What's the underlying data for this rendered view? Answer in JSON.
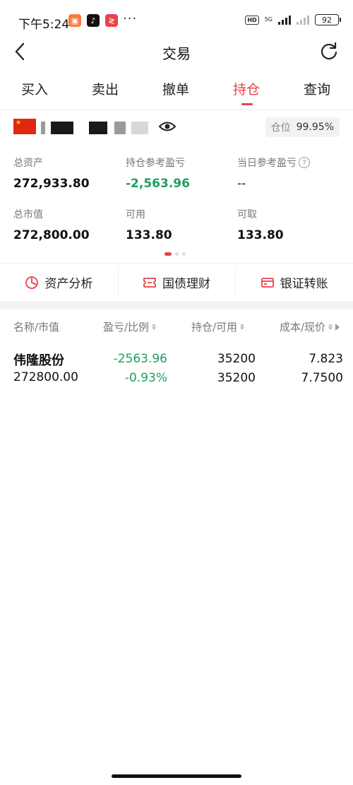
{
  "status_bar": {
    "time": "下午5:24",
    "network": "5G",
    "battery": "92"
  },
  "header": {
    "title": "交易"
  },
  "tabs": [
    {
      "label": "买入",
      "active": false
    },
    {
      "label": "卖出",
      "active": false
    },
    {
      "label": "撤单",
      "active": false
    },
    {
      "label": "持仓",
      "active": true
    },
    {
      "label": "查询",
      "active": false
    }
  ],
  "account": {
    "position_label": "仓位",
    "position_value": "99.95%"
  },
  "metrics": {
    "total_assets_label": "总资产",
    "total_assets": "272,933.80",
    "holding_pl_label": "持仓参考盈亏",
    "holding_pl": "-2,563.96",
    "today_pl_label": "当日参考盈亏",
    "today_pl": "--",
    "market_value_label": "总市值",
    "market_value": "272,800.00",
    "available_label": "可用",
    "available": "133.80",
    "withdrawable_label": "可取",
    "withdrawable": "133.80"
  },
  "quick_actions": [
    {
      "label": "资产分析",
      "icon": "pie-chart-icon"
    },
    {
      "label": "国债理财",
      "icon": "ticket-icon"
    },
    {
      "label": "银证转账",
      "icon": "card-icon"
    }
  ],
  "table": {
    "headers": [
      "名称/市值",
      "盈亏/比例",
      "持仓/可用",
      "成本/现价"
    ],
    "rows": [
      {
        "name": "伟隆股份",
        "market_value": "272800.00",
        "pl": "-2563.96",
        "pl_ratio": "-0.93%",
        "holding": "35200",
        "available": "35200",
        "cost": "7.823",
        "price": "7.7500"
      }
    ]
  },
  "colors": {
    "accent": "#e8434a",
    "loss": "#1e9e5c"
  }
}
